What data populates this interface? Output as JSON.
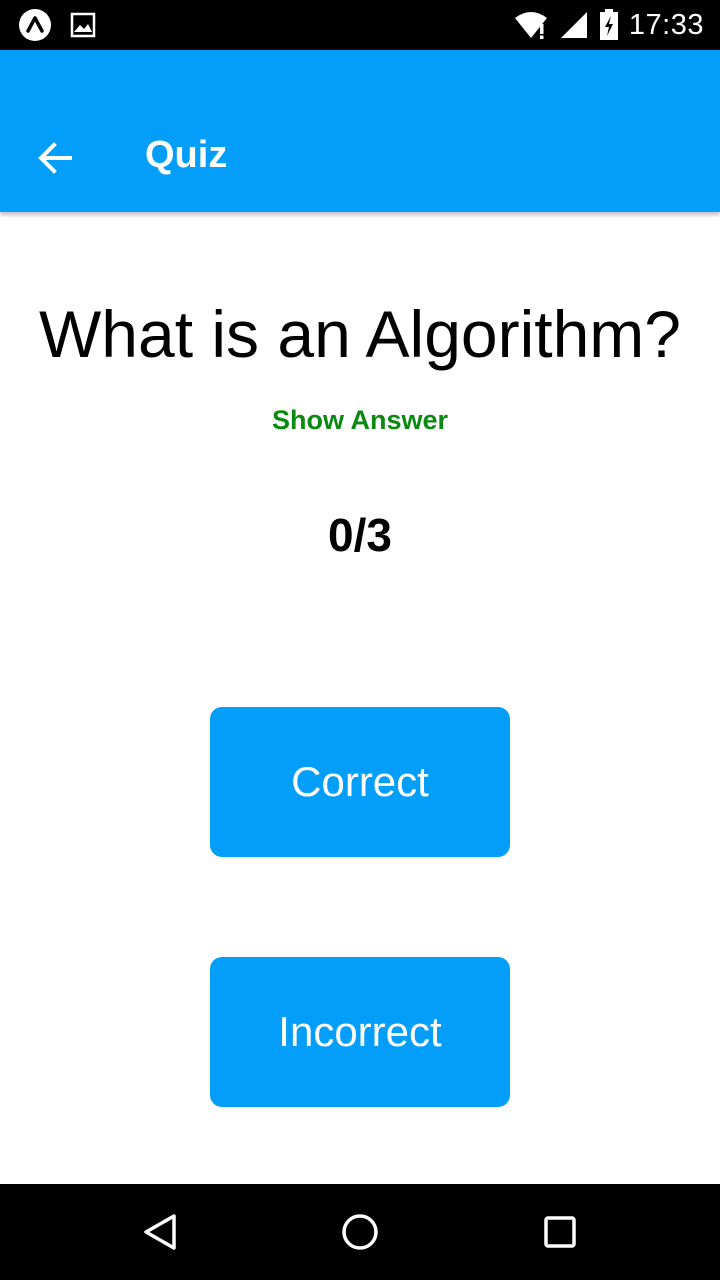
{
  "status_bar": {
    "time": "17:33",
    "icons": [
      "expo-icon",
      "image-icon",
      "wifi-icon",
      "signal-icon",
      "battery-charging-icon"
    ]
  },
  "app_bar": {
    "title": "Quiz",
    "back_icon": "arrow-back-icon"
  },
  "quiz": {
    "question": "What is an Algorithm?",
    "show_answer_label": "Show Answer",
    "score": "0/3"
  },
  "actions": {
    "correct_label": "Correct",
    "incorrect_label": "Incorrect"
  },
  "nav_bar": {
    "icons": [
      "nav-back-icon",
      "nav-home-icon",
      "nav-recents-icon"
    ]
  },
  "colors": {
    "accent": "#039ef9",
    "show_answer": "#0a8a10",
    "status_bar": "#000000"
  }
}
